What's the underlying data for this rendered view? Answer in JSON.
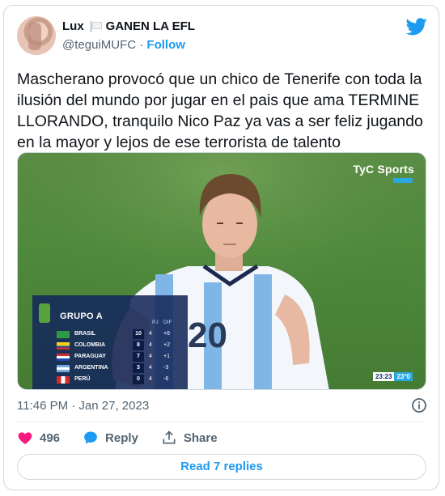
{
  "user": {
    "display_name": "Lux",
    "display_name_suffix": "GANEN LA EFL",
    "handle": "@teguiMUFC",
    "separator": "·",
    "follow_label": "Follow"
  },
  "tweet": {
    "text": "Mascherano provocó que un chico de Tenerife con toda la ilusión del mundo por jugar en el pais que ama TERMINE LLORANDO, tranquilo Nico Paz ya vas a ser feliz jugando en la mayor y lejos de ese terrorista de talento"
  },
  "media": {
    "broadcaster": "TyC Sports",
    "player_number": "20",
    "standings": {
      "title": "GRUPO A",
      "col_pj": "PJ",
      "col_dif": "DIF",
      "rows": [
        {
          "team": "BRASIL",
          "pts": "10",
          "pj": "4",
          "dif": "+6"
        },
        {
          "team": "COLOMBIA",
          "pts": "8",
          "pj": "4",
          "dif": "+2"
        },
        {
          "team": "PARAGUAY",
          "pts": "7",
          "pj": "4",
          "dif": "+1"
        },
        {
          "team": "ARGENTINA",
          "pts": "3",
          "pj": "4",
          "dif": "-3"
        },
        {
          "team": "PERÚ",
          "pts": "0",
          "pj": "4",
          "dif": "-6"
        }
      ]
    },
    "clock_time": "23:23",
    "clock_temp": "23°0"
  },
  "meta": {
    "timestamp": "11:46 PM · Jan 27, 2023"
  },
  "actions": {
    "likes": "496",
    "reply_label": "Reply",
    "share_label": "Share",
    "read_replies_label": "Read 7 replies"
  },
  "colors": {
    "accent": "#1d9bf0",
    "like": "#f91880",
    "text_secondary": "#536471",
    "border": "#cfd9de"
  },
  "icons": [
    "twitter-bird-icon",
    "flag-icon",
    "info-icon",
    "heart-icon",
    "reply-bubble-icon",
    "share-icon"
  ]
}
